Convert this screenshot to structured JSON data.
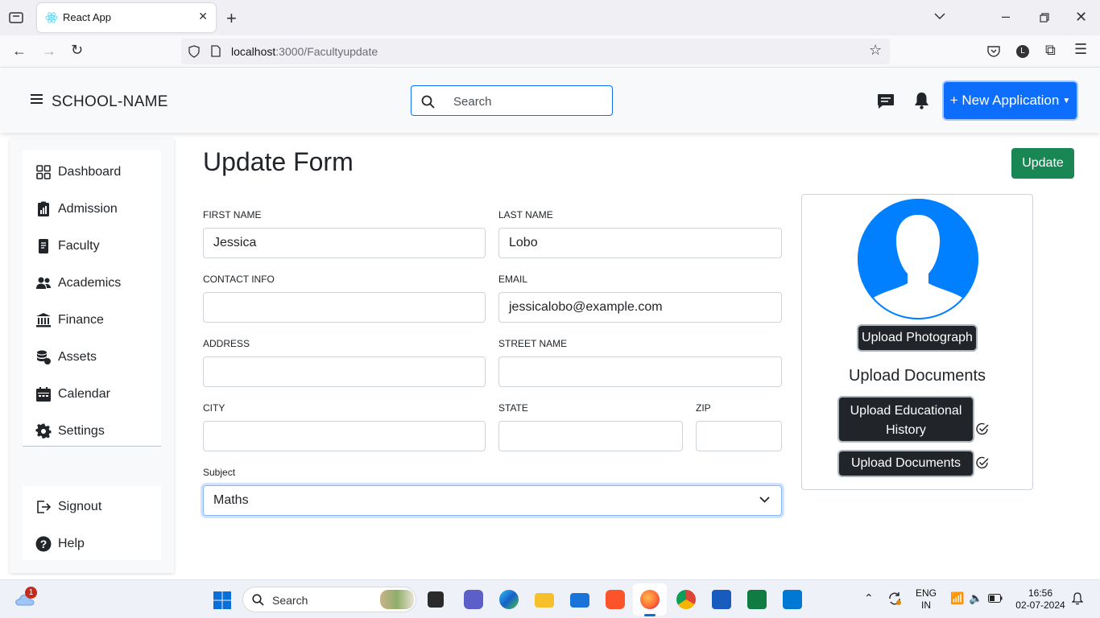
{
  "browser": {
    "tab_title": "React App",
    "url_host": "localhost",
    "url_rest": ":3000/Facultyupdate"
  },
  "header": {
    "brand": "SCHOOL-NAME",
    "search_placeholder": "Search",
    "new_application": "+ New Application"
  },
  "sidebar": {
    "items": [
      {
        "label": "Dashboard",
        "icon": "grid-icon"
      },
      {
        "label": "Admission",
        "icon": "clipboard-chart-icon"
      },
      {
        "label": "Faculty",
        "icon": "document-icon"
      },
      {
        "label": "Academics",
        "icon": "people-icon"
      },
      {
        "label": "Finance",
        "icon": "bank-icon"
      },
      {
        "label": "Assets",
        "icon": "database-icon"
      },
      {
        "label": "Calendar",
        "icon": "calendar-icon"
      },
      {
        "label": "Settings",
        "icon": "gear-icon"
      }
    ],
    "bottom": [
      {
        "label": "Signout",
        "icon": "signout-icon"
      },
      {
        "label": "Help",
        "icon": "help-icon"
      }
    ]
  },
  "form": {
    "title": "Update Form",
    "update_button": "Update",
    "first_name_label": "FIRST NAME",
    "first_name_value": "Jessica",
    "last_name_label": "LAST NAME",
    "last_name_value": "Lobo",
    "contact_label": "CONTACT INFO",
    "contact_value": "",
    "email_label": "EMAIL",
    "email_value": "jessicalobo@example.com",
    "address_label": "ADDRESS",
    "address_value": "",
    "street_label": "STREET NAME",
    "street_value": "",
    "city_label": "CITY",
    "city_value": "",
    "state_label": "STATE",
    "state_value": "",
    "zip_label": "ZIP",
    "zip_value": "",
    "subject_label": "Subject",
    "subject_value": "Maths"
  },
  "upload": {
    "photo_button": "Upload Photograph",
    "docs_title": "Upload Documents",
    "edu_button_line1": "Upload Educational",
    "edu_button_line2": "History",
    "docs_button": "Upload Documents"
  },
  "taskbar": {
    "search": "Search",
    "lang1": "ENG",
    "lang2": "IN",
    "time": "16:56",
    "date": "02-07-2024",
    "weather_badge": "1"
  },
  "colors": {
    "primary": "#0d6efd",
    "success": "#198754",
    "dark": "#212529",
    "avatar": "#0080ff"
  }
}
